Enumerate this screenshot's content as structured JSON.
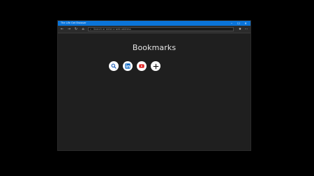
{
  "window": {
    "title": "The Life Get Browser"
  },
  "controls": {
    "minimize": "–",
    "maximize": "☐",
    "close": "✕"
  },
  "toolbar": {
    "back": "←",
    "forward": "→",
    "reload": "↻",
    "home": "⌂",
    "address_placeholder": "Search or enter a web address",
    "favorites": "★",
    "more": "⋯"
  },
  "page": {
    "heading": "Bookmarks"
  },
  "bookmarks": [
    {
      "name": "search-icon",
      "color": "#1a5bb8"
    },
    {
      "name": "linkedin-icon",
      "color": "#0a66c2"
    },
    {
      "name": "youtube-icon",
      "color": "#e02424"
    },
    {
      "name": "add-icon",
      "color": "#111111"
    }
  ],
  "colors": {
    "titlebar": "#0a74d9",
    "background": "#1f1f1f"
  }
}
